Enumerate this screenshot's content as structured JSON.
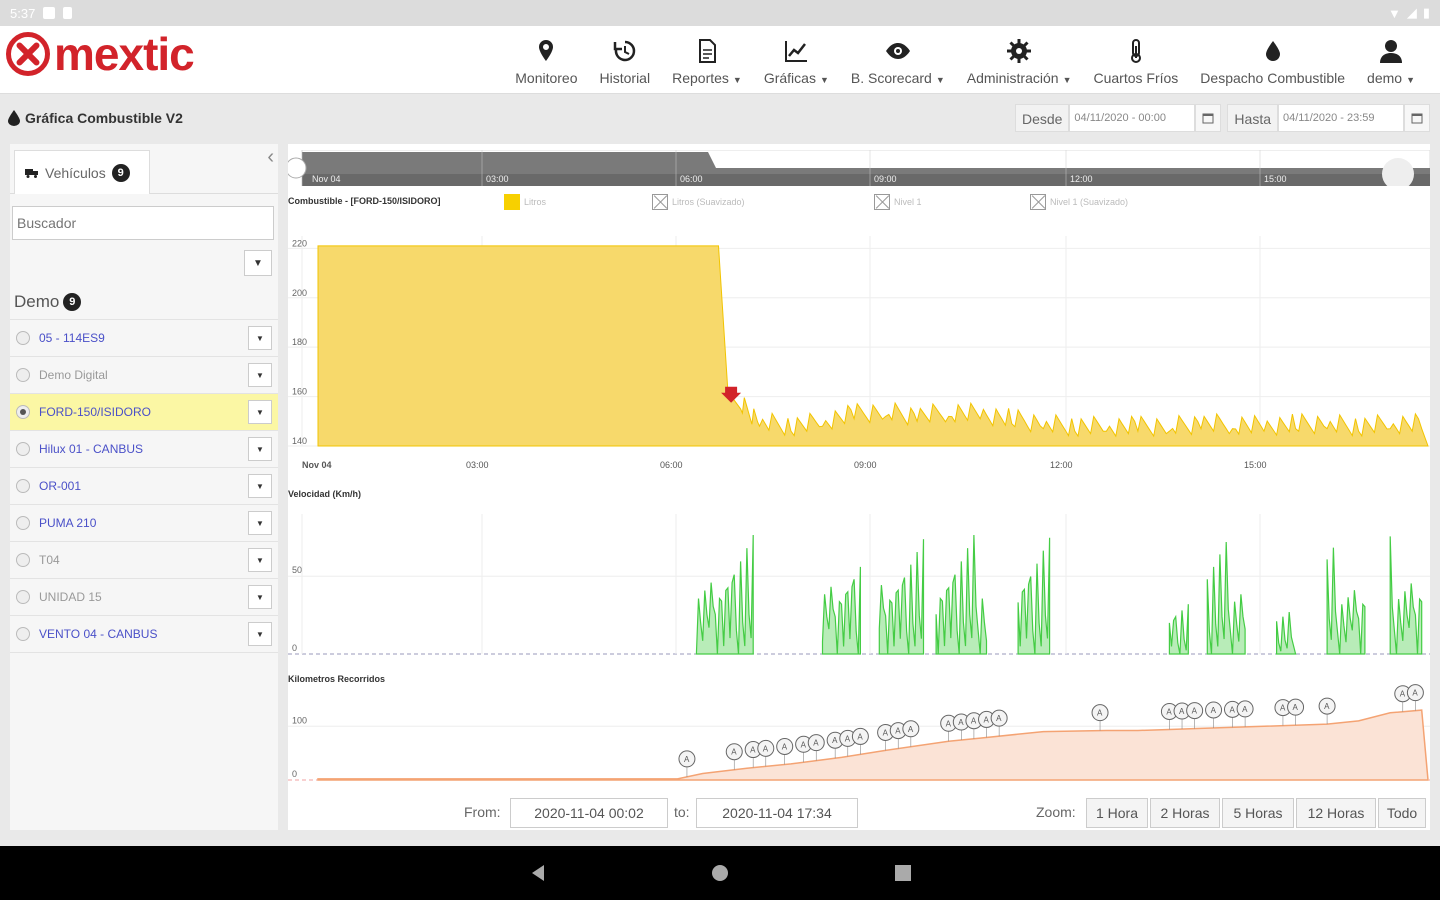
{
  "status": {
    "time": "5:37"
  },
  "brand": {
    "name": "mextic",
    "color": "#d2232a"
  },
  "nav": [
    {
      "label": "Monitoreo",
      "icon": "map-pin-icon",
      "caret": false
    },
    {
      "label": "Historial",
      "icon": "history-icon",
      "caret": false
    },
    {
      "label": "Reportes",
      "icon": "document-icon",
      "caret": true
    },
    {
      "label": "Gráficas",
      "icon": "line-chart-icon",
      "caret": true
    },
    {
      "label": "B. Scorecard",
      "icon": "eye-icon",
      "caret": true
    },
    {
      "label": "Administración",
      "icon": "gear-icon",
      "caret": true
    },
    {
      "label": "Cuartos Fríos",
      "icon": "thermometer-icon",
      "caret": false
    },
    {
      "label": "Despacho Combustible",
      "icon": "drop-icon",
      "caret": false
    },
    {
      "label": "demo",
      "icon": "user-icon",
      "caret": true
    }
  ],
  "page": {
    "title": "Gráfica Combustible V2"
  },
  "daterange": {
    "from_label": "Desde",
    "from_value": "04/11/2020 - 00:00",
    "to_label": "Hasta",
    "to_value": "04/11/2020 - 23:59"
  },
  "sidebar": {
    "tab_label": "Vehículos",
    "tab_count": "9",
    "search_placeholder": "Buscador",
    "group_name": "Demo",
    "group_count": "9",
    "vehicles": [
      {
        "name": "05 - 114ES9",
        "gray": false,
        "selected": false
      },
      {
        "name": "Demo Digital",
        "gray": true,
        "selected": false
      },
      {
        "name": "FORD-150/ISIDORO",
        "gray": false,
        "selected": true
      },
      {
        "name": "Hilux 01 - CANBUS",
        "gray": false,
        "selected": false
      },
      {
        "name": "OR-001",
        "gray": false,
        "selected": false
      },
      {
        "name": "PUMA 210",
        "gray": false,
        "selected": false
      },
      {
        "name": "T04",
        "gray": true,
        "selected": false
      },
      {
        "name": "UNIDAD 15",
        "gray": true,
        "selected": false
      },
      {
        "name": "VENTO 04 - CANBUS",
        "gray": false,
        "selected": false
      }
    ]
  },
  "legend": {
    "title": "Combustible - [FORD-150/ISIDORO]",
    "items": [
      "Litros",
      "Litros (Suavizado)",
      "Nivel 1",
      "Nivel 1 (Suavizado)"
    ]
  },
  "navigator_labels": [
    "Nov 04",
    "03:00",
    "06:00",
    "09:00",
    "12:00",
    "15:00"
  ],
  "chart_data": [
    {
      "type": "area",
      "title": "",
      "series": [
        {
          "name": "Litros",
          "color": "#f7d96b"
        }
      ],
      "x_ticks": [
        "Nov 04",
        "03:00",
        "06:00",
        "09:00",
        "12:00",
        "15:00"
      ],
      "y_ticks": [
        140,
        160,
        180,
        200,
        220
      ],
      "ylim": [
        140,
        225
      ],
      "points": [
        [
          0,
          221
        ],
        [
          6.35,
          221
        ],
        [
          6.5,
          162
        ],
        [
          6.7,
          155
        ],
        [
          7.0,
          148
        ],
        [
          7.5,
          146
        ],
        [
          8.0,
          148
        ],
        [
          8.5,
          151
        ],
        [
          9.0,
          152
        ],
        [
          9.5,
          150
        ],
        [
          10.0,
          152
        ],
        [
          10.5,
          151
        ],
        [
          11.0,
          149
        ],
        [
          11.5,
          147
        ],
        [
          12.0,
          146
        ],
        [
          12.5,
          146
        ],
        [
          13.0,
          146
        ],
        [
          13.5,
          146
        ],
        [
          14.0,
          147
        ],
        [
          14.5,
          147
        ],
        [
          15.0,
          146
        ],
        [
          15.5,
          147
        ],
        [
          16.0,
          147
        ],
        [
          16.5,
          146
        ],
        [
          17.0,
          147
        ],
        [
          17.5,
          147
        ]
      ],
      "marker_x": 6.55
    },
    {
      "type": "area",
      "title": "Velocidad (Km/h)",
      "y_ticks": [
        0,
        50
      ],
      "ylim": [
        0,
        90
      ],
      "color": "#44cc44",
      "bursts": [
        [
          6.0,
          0.9,
          85
        ],
        [
          8.0,
          0.6,
          80
        ],
        [
          8.9,
          0.7,
          82
        ],
        [
          9.8,
          0.8,
          85
        ],
        [
          11.1,
          0.5,
          83
        ],
        [
          13.5,
          0.3,
          40
        ],
        [
          14.1,
          0.6,
          80
        ],
        [
          15.2,
          0.3,
          30
        ],
        [
          16.0,
          0.6,
          76
        ],
        [
          17.0,
          0.5,
          84
        ]
      ]
    },
    {
      "type": "area",
      "title": "Kilometros Recorridos",
      "y_ticks": [
        0,
        100
      ],
      "ylim": [
        0,
        160
      ],
      "color": "#f4a373",
      "points": [
        [
          0,
          2
        ],
        [
          5.7,
          2
        ],
        [
          6.1,
          12
        ],
        [
          6.8,
          22
        ],
        [
          7.5,
          30
        ],
        [
          8.3,
          42
        ],
        [
          9.0,
          55
        ],
        [
          10.0,
          72
        ],
        [
          10.5,
          78
        ],
        [
          11.5,
          90
        ],
        [
          12.5,
          92
        ],
        [
          13.0,
          92
        ],
        [
          13.5,
          94
        ],
        [
          14.0,
          96
        ],
        [
          15.0,
          100
        ],
        [
          16.0,
          104
        ],
        [
          16.5,
          110
        ],
        [
          17.0,
          125
        ],
        [
          17.5,
          130
        ]
      ],
      "labels_badge": "A"
    }
  ],
  "bottom": {
    "from_label": "From:",
    "from_value": "2020-11-04 00:02",
    "to_label": "to:",
    "to_value": "2020-11-04 17:34",
    "zoom_label": "Zoom:",
    "zoom_buttons": [
      "1 Hora",
      "2 Horas",
      "5 Horas",
      "12 Horas",
      "Todo"
    ]
  }
}
